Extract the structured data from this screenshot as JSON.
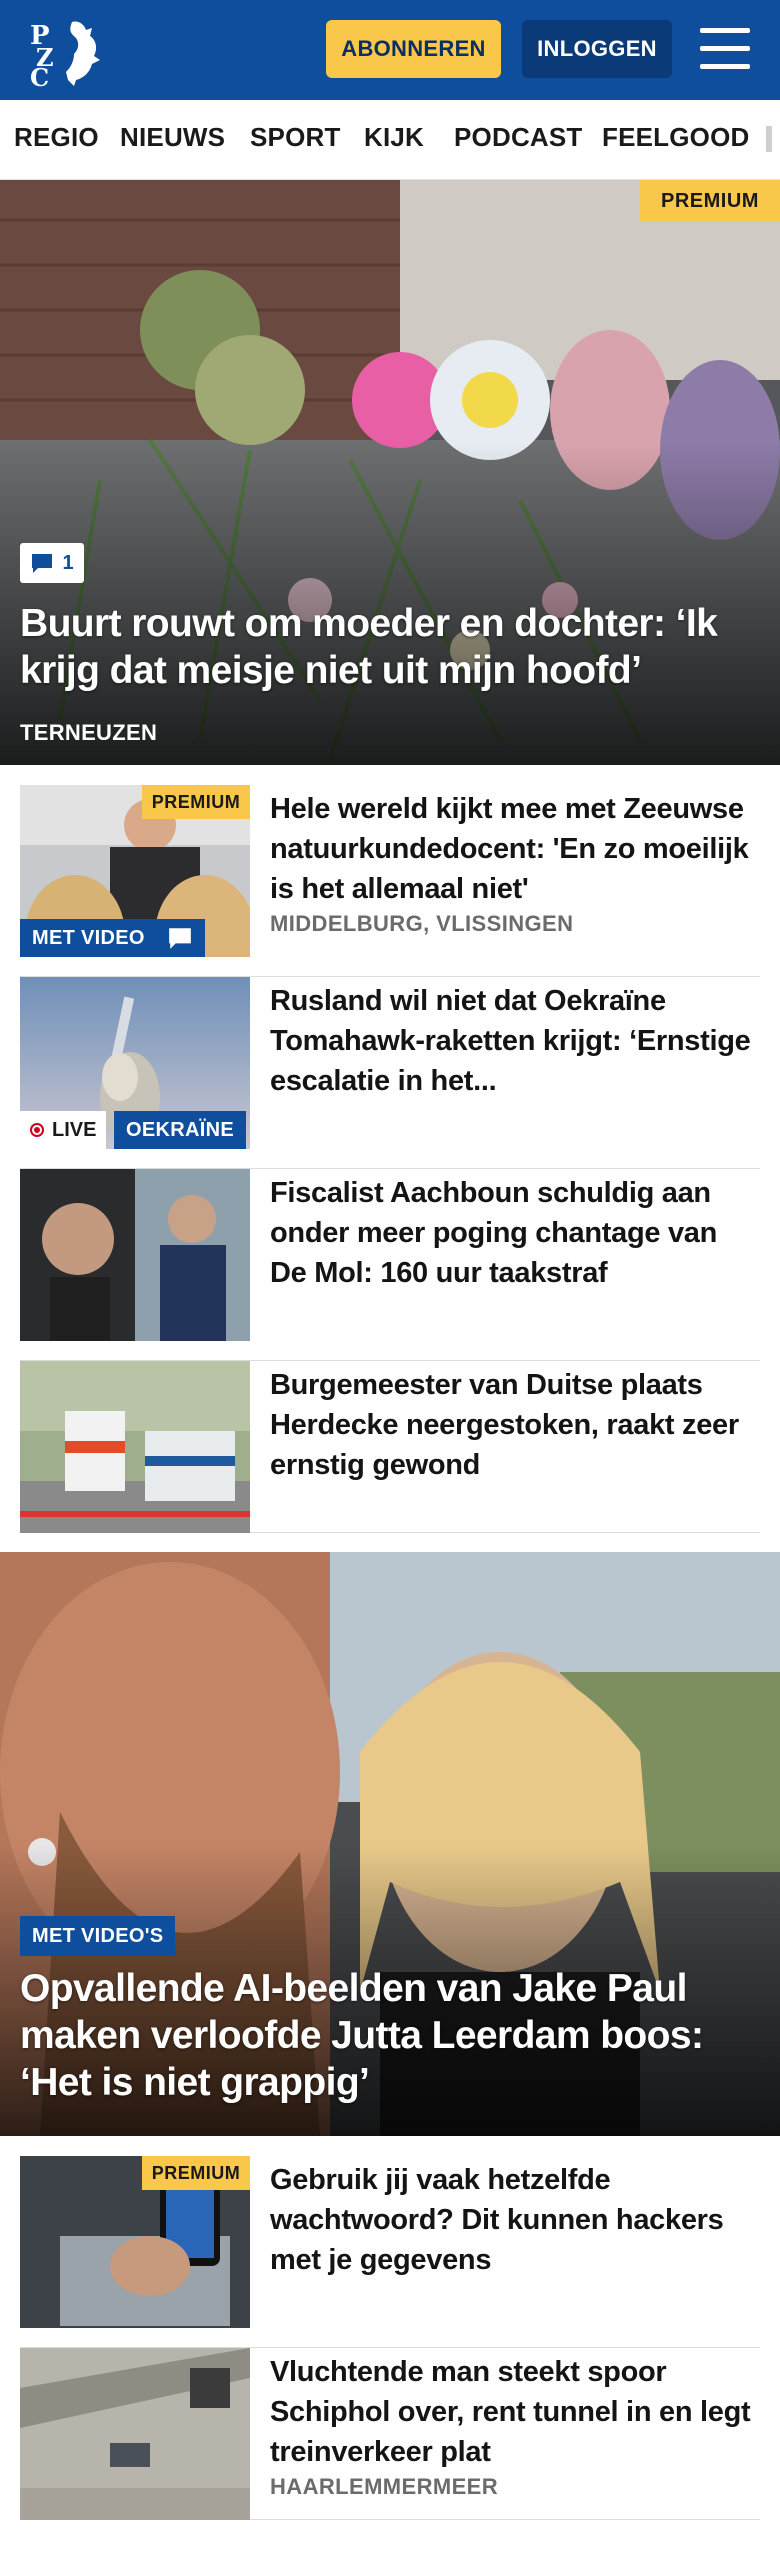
{
  "header": {
    "logo_text": "PZC",
    "subscribe_label": "ABONNEREN",
    "login_label": "INLOGGEN"
  },
  "nav": {
    "items": [
      "REGIO",
      "NIEUWS",
      "SPORT",
      "KIJK",
      "PODCAST",
      "FEELGOOD"
    ]
  },
  "hero1": {
    "premium_label": "PREMIUM",
    "comment_count": "1",
    "title": "Buurt rouwt om moeder en dochter: ‘Ik krijg dat meisje niet uit mijn hoofd’",
    "location": "TERNEUZEN"
  },
  "articles": [
    {
      "premium_label": "PREMIUM",
      "video_label": "MET VIDEO",
      "title": "Hele wereld kijkt mee met Zeeuwse natuurkundedocent: 'En zo moeilijk is het allemaal niet'",
      "location": "MIDDELBURG, VLISSINGEN"
    },
    {
      "live_label": "LIVE",
      "topic_label": "OEKRAÏNE",
      "title": "Rusland wil niet dat Oekraïne Tomahawk-raketten krijgt: ‘Ernstige escalatie in het..."
    },
    {
      "title": "Fiscalist Aachboun schuldig aan onder meer poging chantage van De Mol: 160 uur taakstraf"
    },
    {
      "title": "Burgemeester van Duitse plaats Herdecke neergestoken, raakt zeer ernstig gewond"
    }
  ],
  "hero2": {
    "video_label": "MET VIDEO'S",
    "title": "Opvallende AI-beelden van Jake Paul maken verloofde Jutta Leerdam boos: ‘Het is niet grappig’"
  },
  "articles2": [
    {
      "premium_label": "PREMIUM",
      "title": "Gebruik jij vaak hetzelfde wachtwoord? Dit kunnen hackers met je gegevens"
    },
    {
      "title": "Vluchtende man steekt spoor Schiphol over, rent tunnel in en legt treinverkeer plat",
      "location": "HAARLEMMERMEER"
    }
  ],
  "colors": {
    "brand_blue": "#0f4e9c",
    "premium_yellow": "#f9c84a",
    "live_red": "#d0021b"
  }
}
